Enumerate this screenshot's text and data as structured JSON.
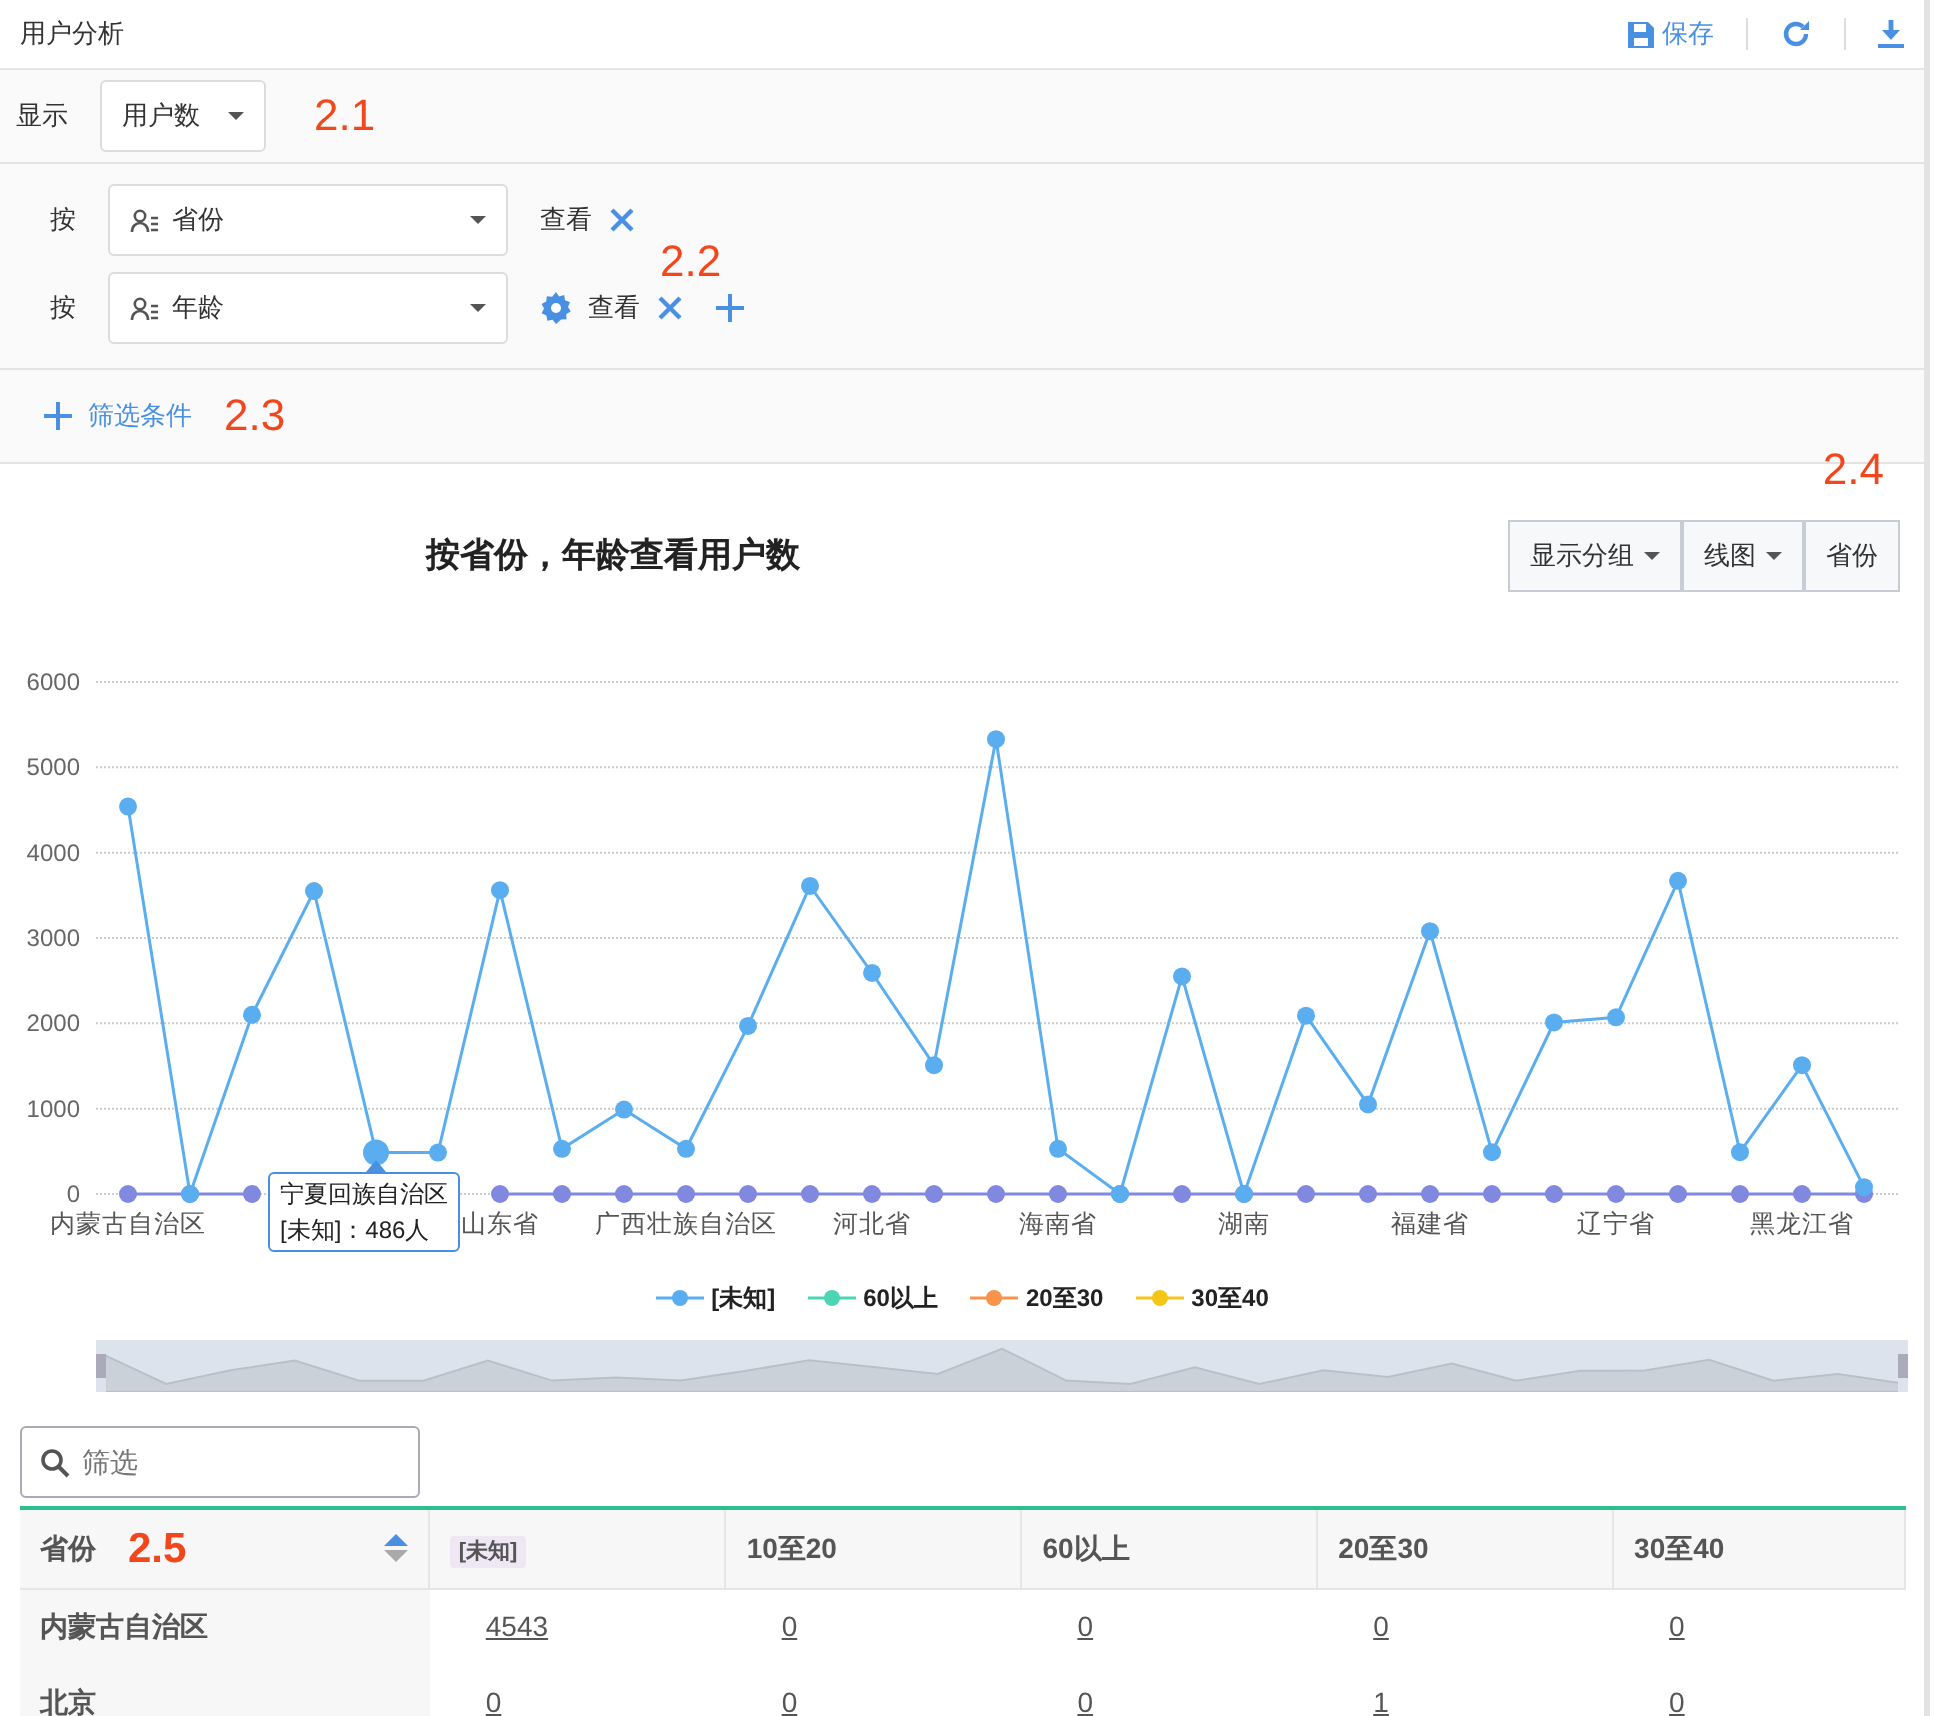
{
  "header": {
    "title": "用户分析",
    "save_label": "保存"
  },
  "measure": {
    "label": "显示",
    "value": "用户数"
  },
  "groups": [
    {
      "prefix": "按",
      "field": "省份",
      "settings": false,
      "action": "查看",
      "add": false
    },
    {
      "prefix": "按",
      "field": "年龄",
      "settings": true,
      "action": "查看",
      "add": true
    }
  ],
  "filter_condition": {
    "label": "筛选条件"
  },
  "callouts": [
    "2.1",
    "2.2",
    "2.3",
    "2.4",
    "2.5"
  ],
  "chart": {
    "title": "按省份，年龄查看用户数",
    "buttons": [
      {
        "label": "显示分组",
        "dropdown": true
      },
      {
        "label": "线图",
        "dropdown": true
      },
      {
        "label": "省份",
        "dropdown": false
      }
    ],
    "chart_data": {
      "type": "line",
      "grid": true,
      "ylim": [
        0,
        6000
      ],
      "yticks": [
        0,
        1000,
        2000,
        3000,
        4000,
        5000,
        6000
      ],
      "categories": [
        "内蒙古自治区",
        null,
        null,
        null,
        "宁夏回族自治区",
        null,
        "山东省",
        null,
        null,
        "广西壮族自治区",
        null,
        null,
        "河北省",
        null,
        null,
        "海南省",
        null,
        null,
        "湖南",
        null,
        null,
        "福建省",
        null,
        null,
        "辽宁省",
        null,
        null,
        "黑龙江省",
        null
      ],
      "series": [
        {
          "name": "[未知]",
          "color": "#5aaef0",
          "marker": "circle",
          "values": [
            4540,
            0,
            2100,
            3550,
            486,
            486,
            3560,
            530,
            990,
            530,
            1970,
            3610,
            2590,
            1510,
            5330,
            530,
            0,
            2550,
            0,
            2090,
            1050,
            3080,
            490,
            2010,
            2070,
            3670,
            490,
            1510,
            80
          ]
        },
        {
          "name": "60以上",
          "color": "#4cd4b4",
          "marker": "circle",
          "values": [
            null,
            null,
            null,
            null,
            null,
            null,
            null,
            null,
            null,
            null,
            null,
            null,
            null,
            null,
            null,
            null,
            null,
            null,
            null,
            null,
            null,
            null,
            null,
            null,
            null,
            null,
            null,
            null,
            null
          ]
        },
        {
          "name": "20至30",
          "color": "#f7934c",
          "marker": "circle",
          "values": [
            null,
            null,
            null,
            null,
            null,
            null,
            null,
            null,
            null,
            null,
            null,
            null,
            null,
            null,
            null,
            null,
            null,
            null,
            null,
            null,
            null,
            null,
            null,
            null,
            null,
            null,
            null,
            null,
            null
          ]
        },
        {
          "name": "30至40",
          "color": "#f5c518",
          "marker": "circle",
          "values": [
            null,
            null,
            null,
            null,
            null,
            null,
            null,
            null,
            null,
            null,
            null,
            null,
            null,
            null,
            null,
            null,
            null,
            null,
            null,
            null,
            null,
            null,
            null,
            null,
            null,
            null,
            null,
            null,
            null
          ]
        },
        {
          "color": "#8088e0",
          "marker": "circle",
          "values": [
            0,
            0,
            0,
            null,
            null,
            null,
            0,
            0,
            0,
            0,
            0,
            0,
            0,
            0,
            0,
            0,
            0,
            0,
            0,
            0,
            0,
            0,
            0,
            0,
            0,
            0,
            0,
            0,
            0
          ]
        }
      ],
      "annotations": [
        {
          "x": "宁夏回族自治区",
          "y": 486,
          "text": "[未知]：486人"
        }
      ]
    },
    "zoom_range": {
      "level": 1
    }
  },
  "table_filter": {
    "placeholder": "筛选"
  },
  "table": {
    "columns": [
      {
        "label": "省份",
        "kind": "sortable"
      },
      {
        "label": "[未知]",
        "kind": "tag"
      },
      {
        "label": "10至20",
        "kind": "plain"
      },
      {
        "label": "60以上",
        "kind": "plain"
      },
      {
        "label": "20至30",
        "kind": "plain"
      },
      {
        "label": "30至40",
        "kind": "plain"
      }
    ],
    "rows": [
      [
        "内蒙古自治区",
        "4543",
        "0",
        "0",
        "0",
        "0"
      ],
      [
        "北京",
        "0",
        "0",
        "0",
        "1",
        "0"
      ]
    ]
  }
}
